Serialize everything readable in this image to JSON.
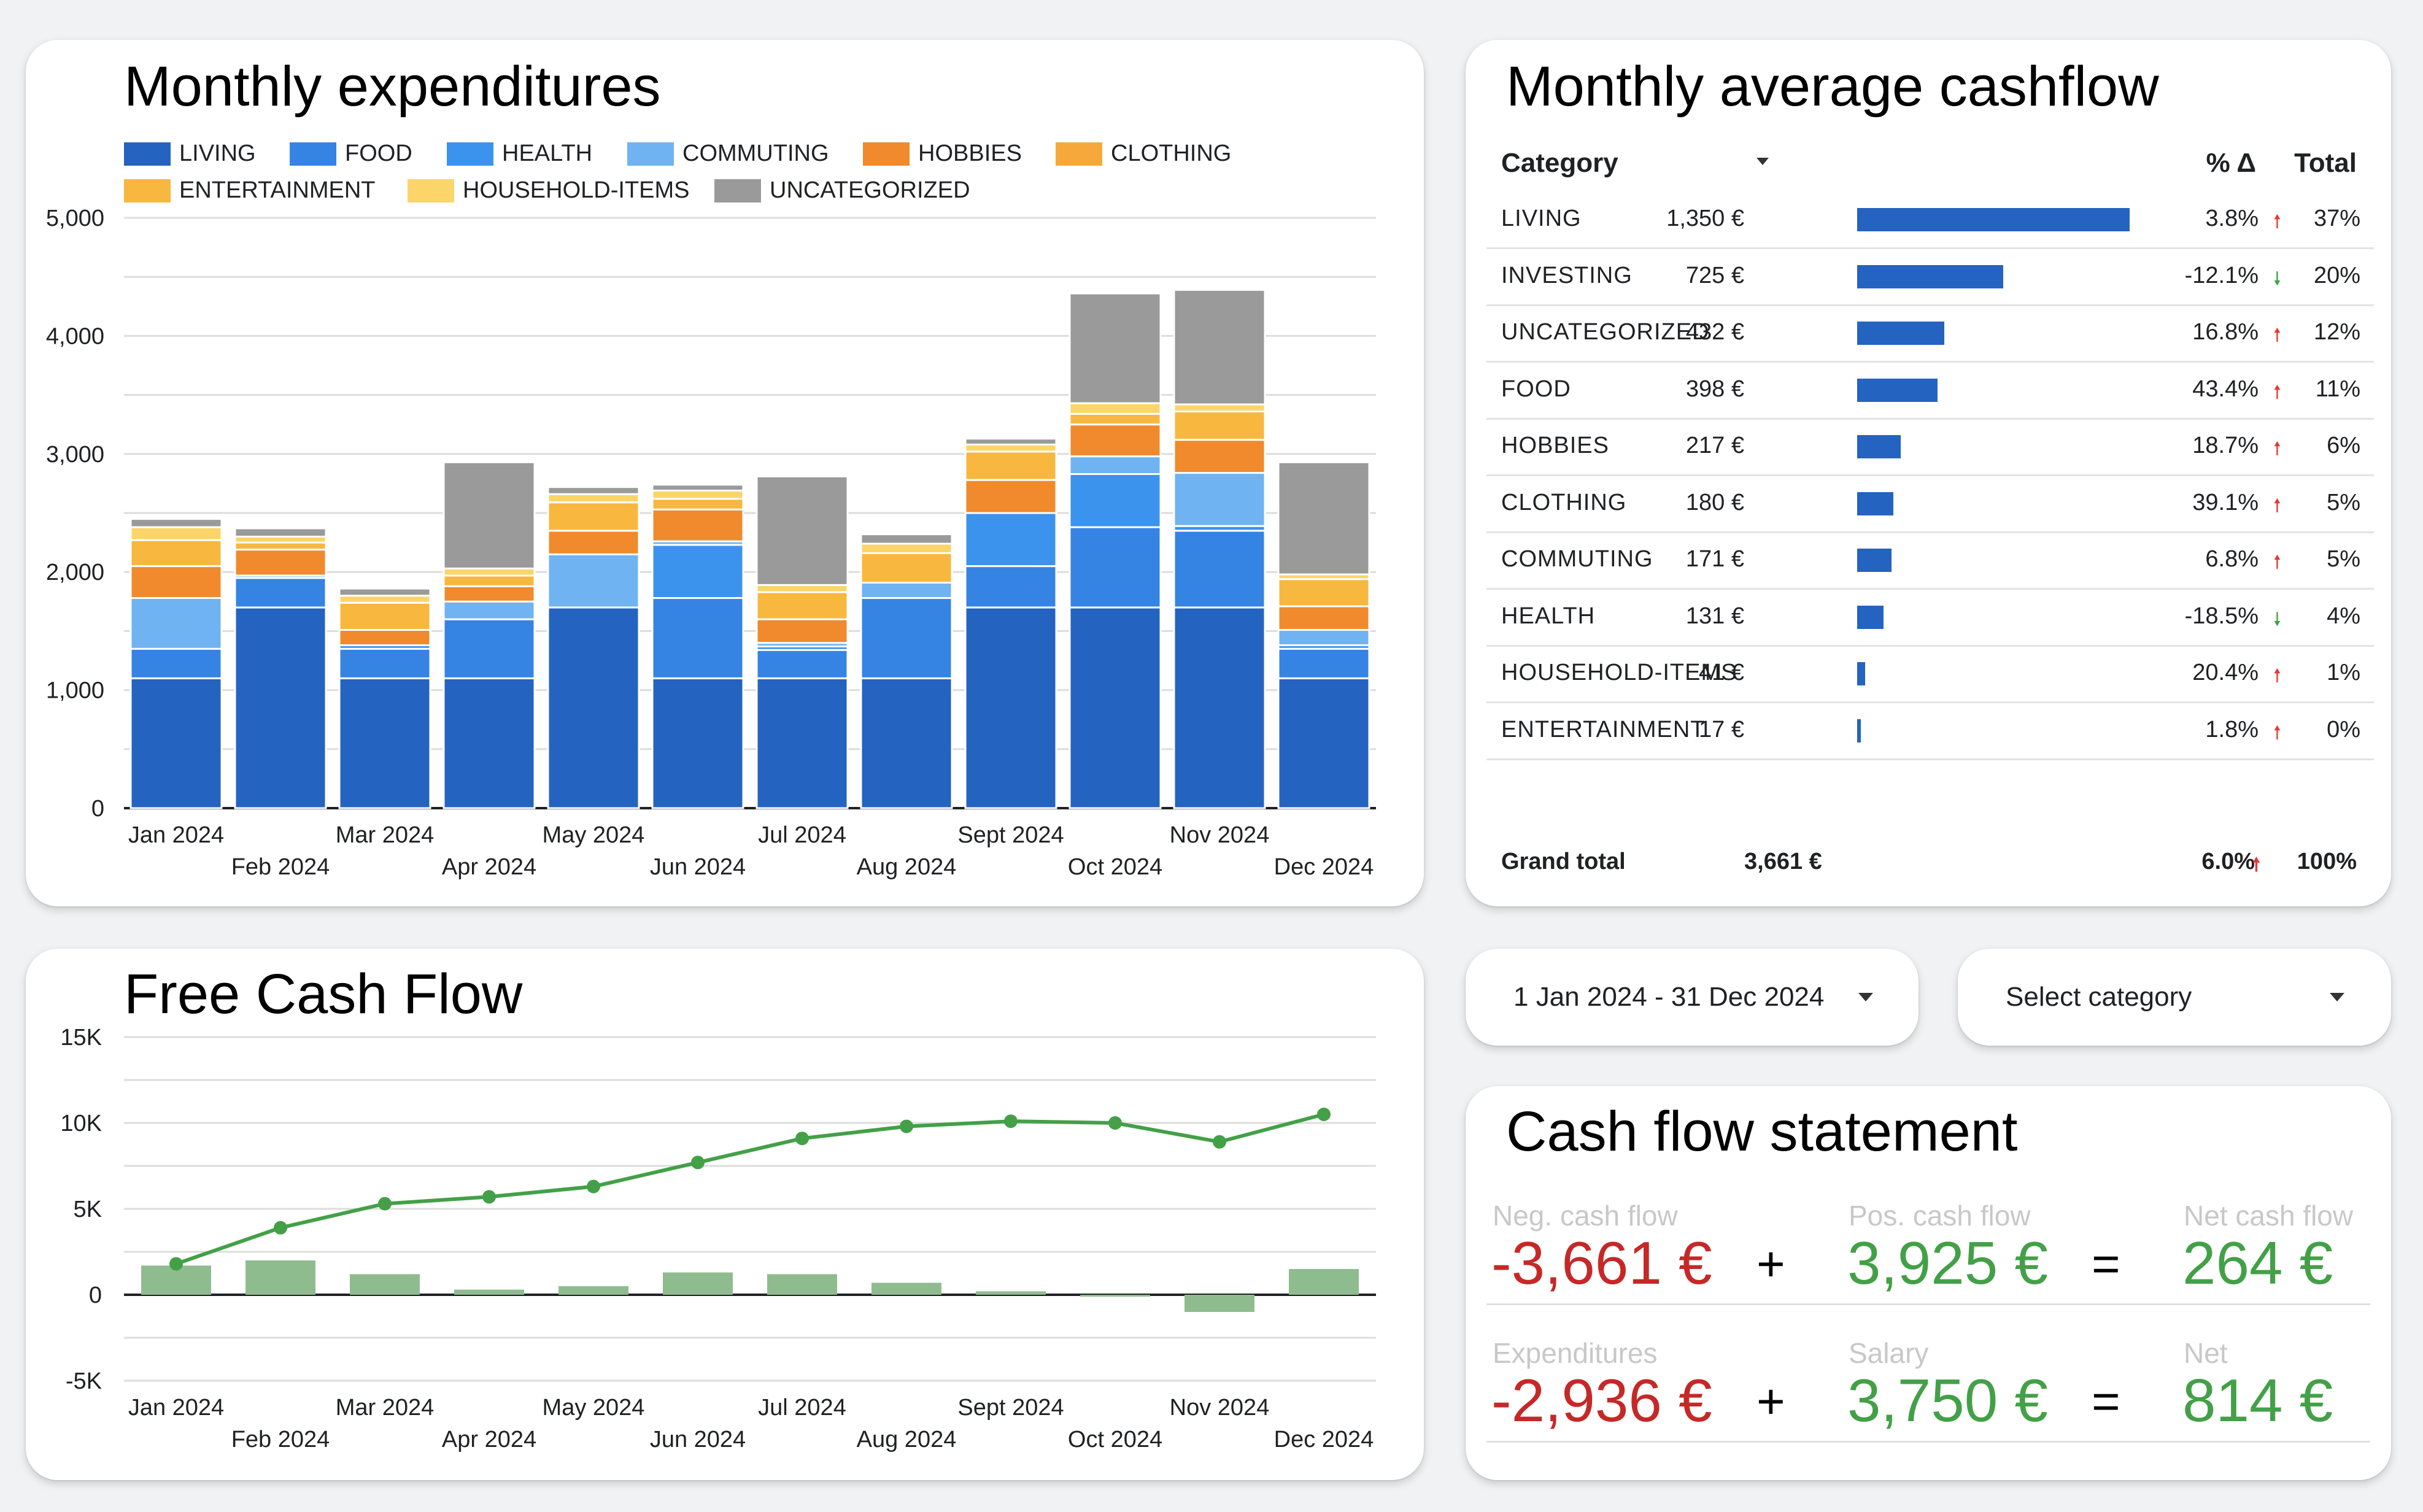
{
  "expenditures": {
    "title": "Monthly expenditures",
    "legend": [
      {
        "name": "LIVING",
        "color": "#2563c0"
      },
      {
        "name": "FOOD",
        "color": "#3584e4"
      },
      {
        "name": "HEALTH",
        "color": "#3c93ee"
      },
      {
        "name": "COMMUTING",
        "color": "#6fb3f2"
      },
      {
        "name": "HOBBIES",
        "color": "#f08a2c"
      },
      {
        "name": "CLOTHING",
        "color": "#f6a93a"
      },
      {
        "name": "ENTERTAINMENT",
        "color": "#f8b73e"
      },
      {
        "name": "HOUSEHOLD-ITEMS",
        "color": "#fbd46a"
      },
      {
        "name": "UNCATEGORIZED",
        "color": "#9a9a9a"
      }
    ]
  },
  "cashflow_table": {
    "title": "Monthly average cashflow",
    "headers": {
      "category": "Category",
      "delta": "% Δ",
      "total": "Total"
    },
    "rows": [
      {
        "category": "LIVING",
        "value": "1,350 €",
        "amount": 1350,
        "delta": "3.8%",
        "dir": "up",
        "total": "37%"
      },
      {
        "category": "INVESTING",
        "value": "725 €",
        "amount": 725,
        "delta": "-12.1%",
        "dir": "down",
        "total": "20%"
      },
      {
        "category": "UNCATEGORIZED",
        "value": "432 €",
        "amount": 432,
        "delta": "16.8%",
        "dir": "up",
        "total": "12%"
      },
      {
        "category": "FOOD",
        "value": "398 €",
        "amount": 398,
        "delta": "43.4%",
        "dir": "up",
        "total": "11%"
      },
      {
        "category": "HOBBIES",
        "value": "217 €",
        "amount": 217,
        "delta": "18.7%",
        "dir": "up",
        "total": "6%"
      },
      {
        "category": "CLOTHING",
        "value": "180 €",
        "amount": 180,
        "delta": "39.1%",
        "dir": "up",
        "total": "5%"
      },
      {
        "category": "COMMUTING",
        "value": "171 €",
        "amount": 171,
        "delta": "6.8%",
        "dir": "up",
        "total": "5%"
      },
      {
        "category": "HEALTH",
        "value": "131 €",
        "amount": 131,
        "delta": "-18.5%",
        "dir": "down",
        "total": "4%"
      },
      {
        "category": "HOUSEHOLD-ITEMS",
        "value": "41 €",
        "amount": 41,
        "delta": "20.4%",
        "dir": "up",
        "total": "1%"
      },
      {
        "category": "ENTERTAINMENT",
        "value": "17 €",
        "amount": 17,
        "delta": "1.8%",
        "dir": "up",
        "total": "0%"
      }
    ],
    "grand_total": {
      "label": "Grand total",
      "value": "3,661 €",
      "delta": "6.0%",
      "total": "100%"
    }
  },
  "free_cash_flow": {
    "title": "Free Cash Flow"
  },
  "filters": {
    "date_range": "1 Jan 2024 - 31 Dec 2024",
    "category": "Select category"
  },
  "statement": {
    "title": "Cash flow statement",
    "rows": [
      {
        "a_label": "Neg. cash flow",
        "a_value": "-3,661 €",
        "b_label": "Pos. cash flow",
        "b_value": "3,925 €",
        "c_label": "Net cash flow",
        "c_value": "264 €"
      },
      {
        "a_label": "Expenditures",
        "a_value": "-2,936 €",
        "b_label": "Salary",
        "b_value": "3,750 €",
        "c_label": "Net",
        "c_value": "814 €"
      }
    ],
    "plus": "+",
    "equals": "="
  },
  "chart_data": [
    {
      "type": "bar",
      "stacked": true,
      "categories": [
        "Jan 2024",
        "Feb 2024",
        "Mar 2024",
        "Apr 2024",
        "May 2024",
        "Jun 2024",
        "Jul 2024",
        "Aug 2024",
        "Sept 2024",
        "Oct 2024",
        "Nov 2024",
        "Dec 2024"
      ],
      "yticks": [
        "0",
        "1,000",
        "2,000",
        "3,000",
        "4,000",
        "5,000"
      ],
      "ylim": [
        0,
        5000
      ],
      "series": [
        {
          "name": "LIVING",
          "color": "#2563c0",
          "values": [
            1100,
            1700,
            1100,
            1100,
            1700,
            1100,
            1100,
            1100,
            1700,
            1700,
            1700,
            1100
          ]
        },
        {
          "name": "FOOD",
          "color": "#3584e4",
          "values": [
            250,
            250,
            250,
            500,
            0,
            680,
            240,
            680,
            350,
            680,
            650,
            250
          ]
        },
        {
          "name": "HEALTH",
          "color": "#3c93ee",
          "values": [
            0,
            0,
            30,
            0,
            0,
            450,
            30,
            0,
            450,
            450,
            40,
            30
          ]
        },
        {
          "name": "COMMUTING",
          "color": "#6fb3f2",
          "values": [
            430,
            20,
            0,
            150,
            450,
            30,
            30,
            130,
            0,
            150,
            450,
            130
          ]
        },
        {
          "name": "HOBBIES",
          "color": "#f08a2c",
          "values": [
            270,
            220,
            130,
            130,
            200,
            270,
            200,
            0,
            280,
            270,
            280,
            200
          ]
        },
        {
          "name": "CLOTHING",
          "color": "#f6a93a",
          "values": [
            0,
            0,
            0,
            0,
            0,
            0,
            0,
            0,
            0,
            0,
            0,
            0
          ]
        },
        {
          "name": "ENTERTAINMENT",
          "color": "#f8b73e",
          "values": [
            220,
            60,
            230,
            90,
            240,
            90,
            230,
            250,
            240,
            90,
            240,
            230
          ]
        },
        {
          "name": "HOUSEHOLD-ITEMS",
          "color": "#fbd46a",
          "values": [
            110,
            50,
            60,
            60,
            70,
            70,
            60,
            80,
            60,
            90,
            60,
            40
          ]
        },
        {
          "name": "UNCATEGORIZED",
          "color": "#9a9a9a",
          "values": [
            70,
            70,
            60,
            900,
            60,
            50,
            920,
            80,
            50,
            930,
            970,
            950
          ]
        }
      ]
    },
    {
      "type": "line+bar",
      "categories": [
        "Jan 2024",
        "Feb 2024",
        "Mar 2024",
        "Apr 2024",
        "May 2024",
        "Jun 2024",
        "Jul 2024",
        "Aug 2024",
        "Sept 2024",
        "Oct 2024",
        "Nov 2024",
        "Dec 2024"
      ],
      "yticks": [
        "-5K",
        "0",
        "5K",
        "10K",
        "15K"
      ],
      "ylim": [
        -5000,
        15000
      ],
      "series": [
        {
          "values": [
            1700,
            2000,
            1200,
            300,
            500,
            1300,
            1200,
            700,
            200,
            -100,
            -1000,
            1500
          ],
          "color": "#8fbc8f",
          "kind": "bar"
        },
        {
          "values": [
            1800,
            3900,
            5300,
            5700,
            6300,
            7700,
            9100,
            9800,
            10100,
            10000,
            8900,
            10500
          ],
          "color": "#43a047",
          "kind": "line"
        }
      ]
    }
  ]
}
